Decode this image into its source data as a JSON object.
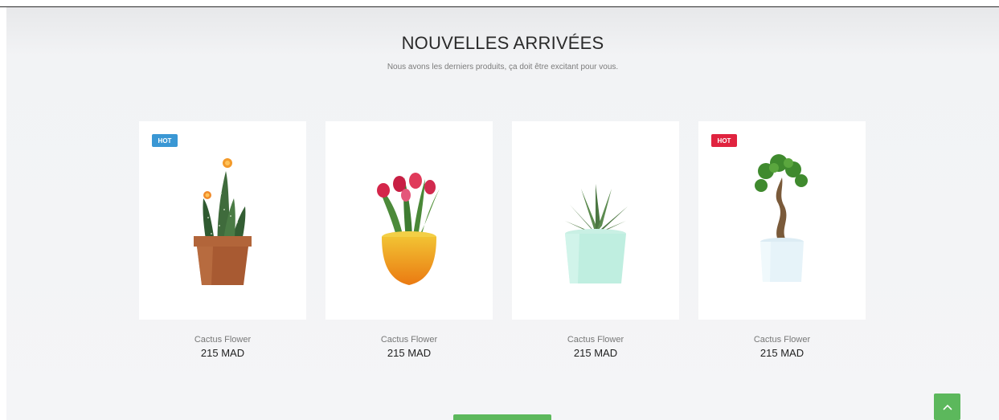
{
  "section": {
    "title": "NOUVELLES ARRIVÉES",
    "subtitle": "Nous avons les derniers produits, ça doit être excitant pour vous."
  },
  "products": [
    {
      "name": "Cactus Flower",
      "price": "215 MAD",
      "badge": "HOT",
      "badge_color": "#3a97d4",
      "image": "cactus-in-terracotta-pot"
    },
    {
      "name": "Cactus Flower",
      "price": "215 MAD",
      "badge": "",
      "image": "tulips-in-orange-pot"
    },
    {
      "name": "Cactus Flower",
      "price": "215 MAD",
      "badge": "",
      "image": "aloe-in-mint-pot"
    },
    {
      "name": "Cactus Flower",
      "price": "215 MAD",
      "badge": "HOT",
      "badge_color": "#e0233f",
      "image": "bonsai-in-white-pot"
    }
  ],
  "colors": {
    "accent": "#5cb85c"
  },
  "icons": {
    "scroll_top": "chevron-up-icon"
  }
}
